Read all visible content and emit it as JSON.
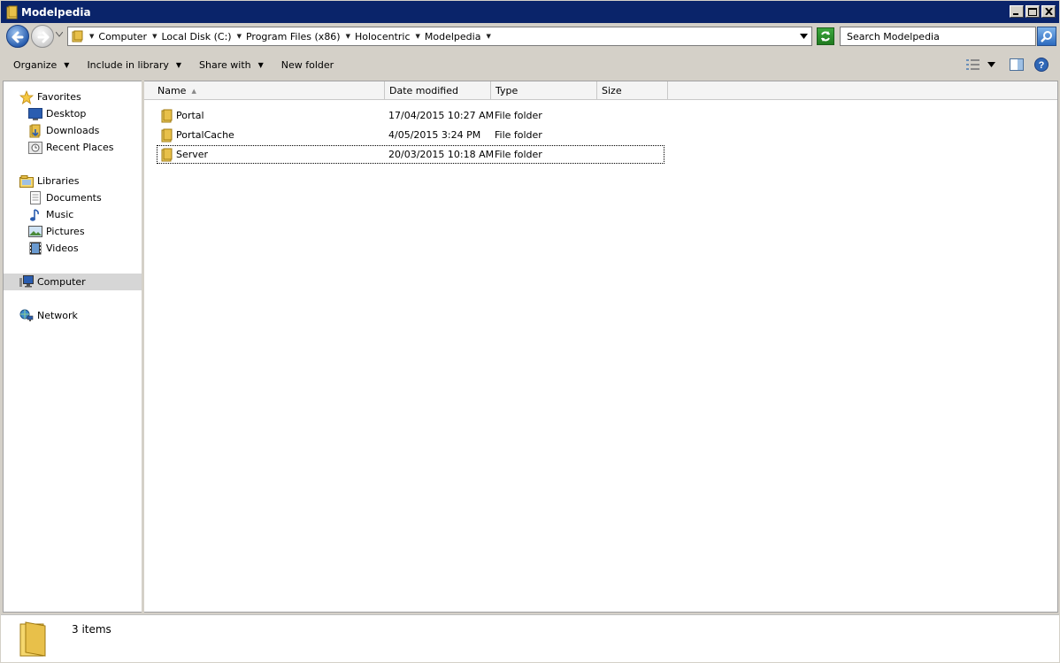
{
  "window": {
    "title": "Modelpedia"
  },
  "address": {
    "crumbs": [
      "Computer",
      "Local Disk (C:)",
      "Program Files (x86)",
      "Holocentric",
      "Modelpedia"
    ]
  },
  "search": {
    "placeholder": "Search Modelpedia"
  },
  "toolbar": {
    "organize": "Organize",
    "include_library": "Include in library",
    "share_with": "Share with",
    "new_folder": "New folder"
  },
  "nav": {
    "favorites": {
      "label": "Favorites",
      "items": [
        {
          "label": "Desktop",
          "icon": "desktop-icon"
        },
        {
          "label": "Downloads",
          "icon": "downloads-icon"
        },
        {
          "label": "Recent Places",
          "icon": "recent-places-icon"
        }
      ]
    },
    "libraries": {
      "label": "Libraries",
      "items": [
        {
          "label": "Documents",
          "icon": "documents-icon"
        },
        {
          "label": "Music",
          "icon": "music-icon"
        },
        {
          "label": "Pictures",
          "icon": "pictures-icon"
        },
        {
          "label": "Videos",
          "icon": "videos-icon"
        }
      ]
    },
    "computer": "Computer",
    "network": "Network"
  },
  "files": {
    "columns": [
      "Name",
      "Date modified",
      "Type",
      "Size"
    ],
    "rows": [
      {
        "name": "Portal",
        "date": "17/04/2015 10:27 AM",
        "type": "File folder",
        "size": ""
      },
      {
        "name": "PortalCache",
        "date": "4/05/2015 3:24 PM",
        "type": "File folder",
        "size": ""
      },
      {
        "name": "Server",
        "date": "20/03/2015 10:18 AM",
        "type": "File folder",
        "size": ""
      }
    ]
  },
  "status": {
    "item_count": "3 items"
  },
  "colors": {
    "title_bar": "#0a246a",
    "chrome": "#d4d0c8",
    "folder": "#e8c04a"
  }
}
